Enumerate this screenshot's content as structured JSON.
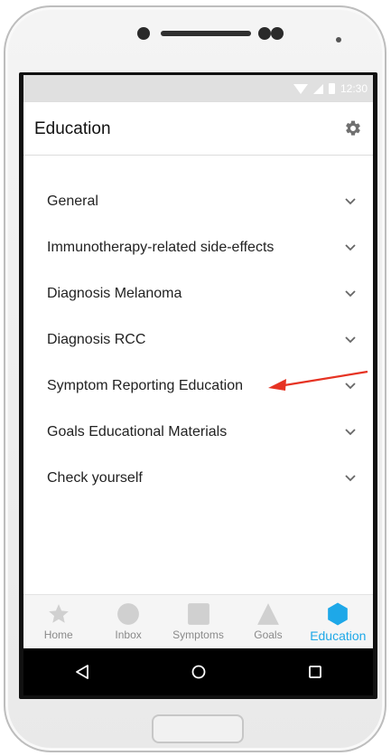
{
  "status_bar": {
    "time": "12:30"
  },
  "app_bar": {
    "title": "Education",
    "settings_icon": "gear-icon"
  },
  "sections": [
    {
      "label": "General"
    },
    {
      "label": "Immunotherapy-related side-effects"
    },
    {
      "label": "Diagnosis Melanoma"
    },
    {
      "label": "Diagnosis RCC"
    },
    {
      "label": "Symptom Reporting Education"
    },
    {
      "label": "Goals Educational Materials"
    },
    {
      "label": "Check yourself"
    }
  ],
  "tabs": [
    {
      "label": "Home",
      "icon": "star-icon",
      "active": false
    },
    {
      "label": "Inbox",
      "icon": "circle-icon",
      "active": false
    },
    {
      "label": "Symptoms",
      "icon": "square-icon",
      "active": false
    },
    {
      "label": "Goals",
      "icon": "triangle-icon",
      "active": false
    },
    {
      "label": "Education",
      "icon": "hexagon-icon",
      "active": true
    }
  ],
  "colors": {
    "accent": "#1ea8e8",
    "annotation_arrow": "#e63323",
    "inactive_icon": "#d0d0d0"
  }
}
